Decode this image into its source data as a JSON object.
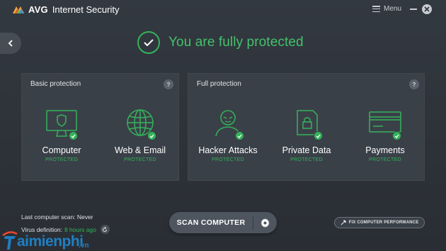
{
  "app": {
    "brand": "AVG",
    "product": "Internet Security",
    "menu_label": "Menu"
  },
  "status": {
    "headline": "You are fully protected",
    "color": "#45c06b"
  },
  "panels": {
    "basic": {
      "title": "Basic protection",
      "help": "?",
      "features": [
        {
          "name": "Computer",
          "status": "PROTECTED",
          "icon": "monitor-shield-icon"
        },
        {
          "name": "Web & Email",
          "status": "PROTECTED",
          "icon": "globe-icon"
        }
      ]
    },
    "full": {
      "title": "Full protection",
      "help": "?",
      "features": [
        {
          "name": "Hacker Attacks",
          "status": "PROTECTED",
          "icon": "hacker-icon"
        },
        {
          "name": "Private Data",
          "status": "PROTECTED",
          "icon": "lock-document-icon"
        },
        {
          "name": "Payments",
          "status": "PROTECTED",
          "icon": "credit-card-icon"
        }
      ]
    }
  },
  "footer": {
    "last_scan_label": "Last computer scan:",
    "last_scan_value": "Never",
    "virus_def_label": "Virus definition:",
    "virus_def_value": "8 hours ago",
    "scan_button": "SCAN COMPUTER",
    "fix_button": "FIX COMPUTER PERFORMANCE"
  },
  "watermark": {
    "text": "aimienphi",
    "suffix": ".vn"
  },
  "colors": {
    "accent_green": "#34b35a",
    "panel_bg": "#3a4048",
    "watermark_blue": "#1f7fc2"
  }
}
